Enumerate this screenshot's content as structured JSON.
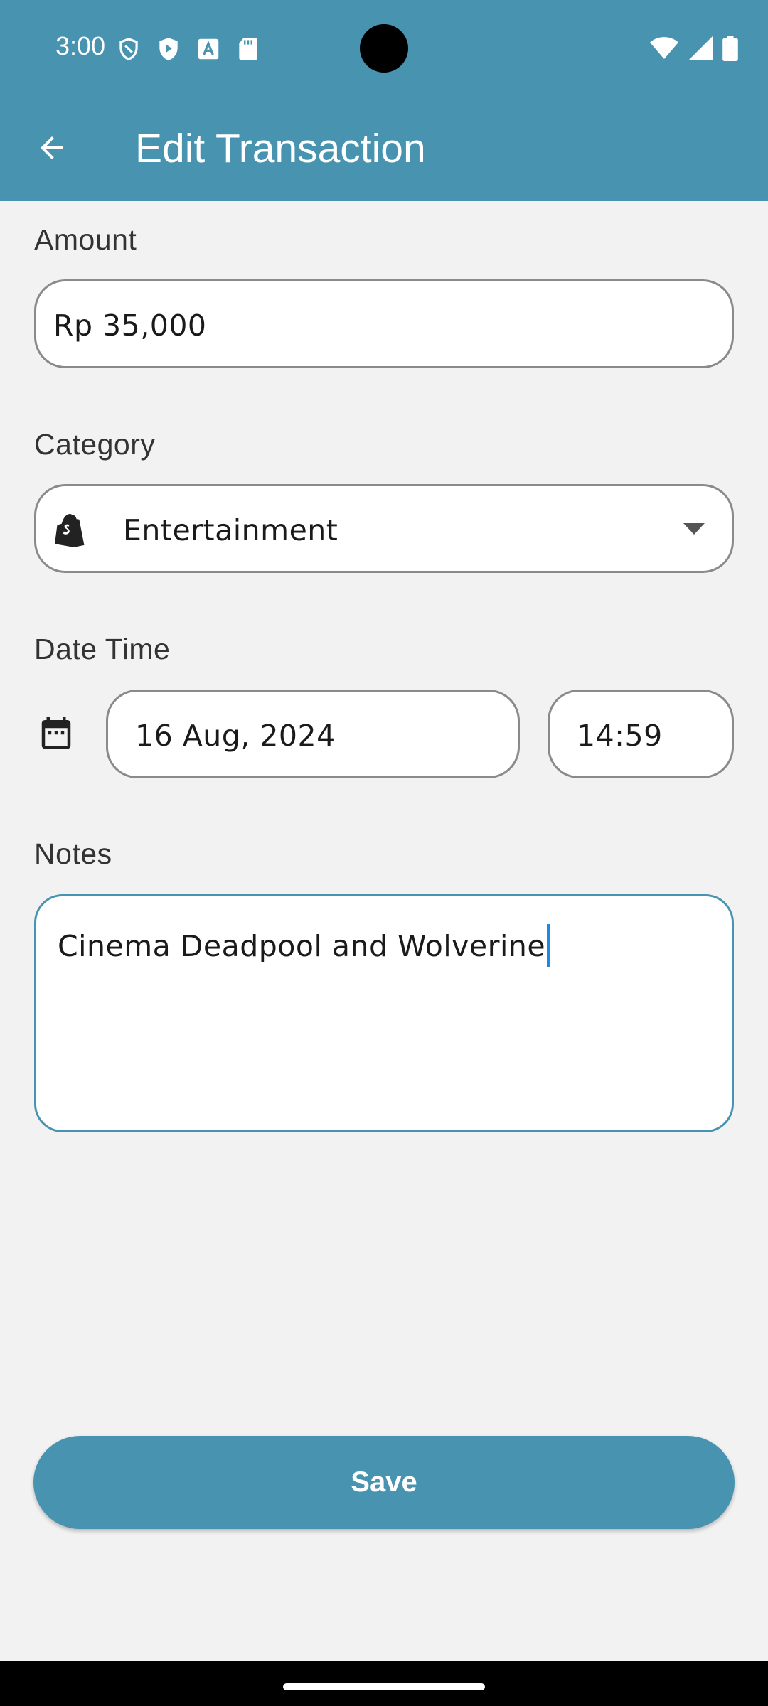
{
  "status_bar": {
    "time": "3:00",
    "left_icons": [
      "shield-outline-icon",
      "play-shield-icon",
      "font-a-icon",
      "sd-card-icon"
    ],
    "right_icons": [
      "wifi-icon",
      "signal-icon",
      "battery-icon"
    ]
  },
  "app_bar": {
    "title": "Edit Transaction",
    "back_icon": "arrow-back-icon"
  },
  "form": {
    "amount": {
      "label": "Amount",
      "value": "Rp 35,000"
    },
    "category": {
      "label": "Category",
      "value": "Entertainment",
      "icon": "shopify-bag-icon"
    },
    "datetime": {
      "label": "Date Time",
      "date": "16 Aug, 2024",
      "time": "14:59",
      "icon": "calendar-icon"
    },
    "notes": {
      "label": "Notes",
      "value": "Cinema Deadpool and Wolverine"
    }
  },
  "actions": {
    "save_label": "Save"
  },
  "colors": {
    "primary": "#4793b0",
    "background": "#f2f2f2",
    "caret": "#1e88e5"
  }
}
